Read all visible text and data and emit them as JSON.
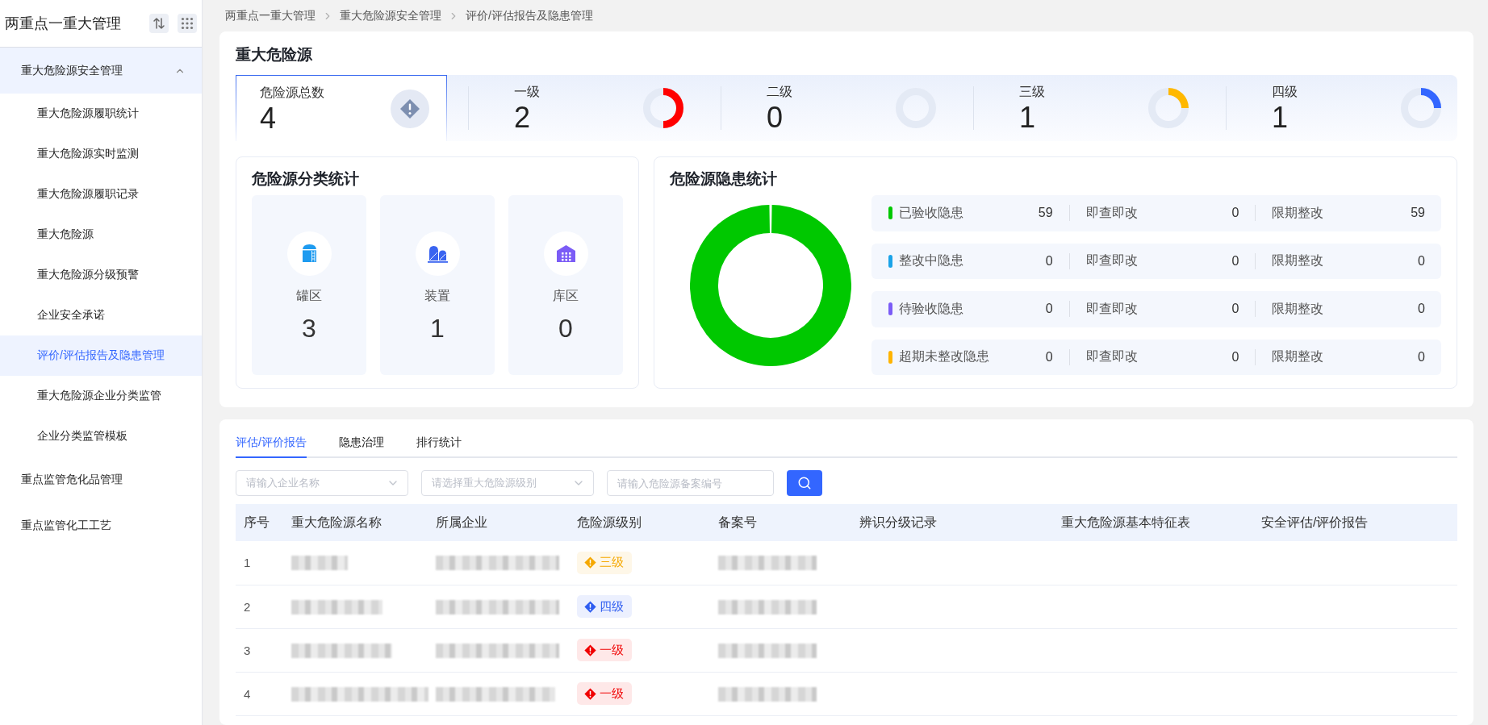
{
  "sidebar": {
    "title": "两重点一重大管理",
    "items": [
      {
        "label": "重大危险源安全管理",
        "selected": false,
        "expanded": true,
        "children": [
          {
            "label": "重大危险源履职统计",
            "selected": false
          },
          {
            "label": "重大危险源实时监测",
            "selected": false
          },
          {
            "label": "重大危险源履职记录",
            "selected": false
          },
          {
            "label": "重大危险源",
            "selected": false
          },
          {
            "label": "重大危险源分级预警",
            "selected": false
          },
          {
            "label": "企业安全承诺",
            "selected": false
          },
          {
            "label": "评价/评估报告及隐患管理",
            "selected": true
          },
          {
            "label": "重大危险源企业分类监管",
            "selected": false
          },
          {
            "label": "企业分类监管模板",
            "selected": false
          }
        ]
      },
      {
        "label": "重点监管危化品管理",
        "selected": false
      },
      {
        "label": "重点监管化工工艺",
        "selected": false
      }
    ]
  },
  "breadcrumb": [
    "两重点一重大管理",
    "重大危险源安全管理",
    "评价/评估报告及隐患管理"
  ],
  "hazard_summary": {
    "title": "重大危险源",
    "total": {
      "label": "危险源总数",
      "value": "4"
    },
    "grades": [
      {
        "label": "一级",
        "value": "2",
        "color": "#ff0000"
      },
      {
        "label": "二级",
        "value": "0"
      },
      {
        "label": "三级",
        "value": "1",
        "color": "#ffb800"
      },
      {
        "label": "四级",
        "value": "1",
        "color": "#3366ff"
      }
    ]
  },
  "category_stats": {
    "title": "危险源分类统计",
    "items": [
      {
        "kind": "tank",
        "label": "罐区",
        "value": "3"
      },
      {
        "kind": "device",
        "label": "装置",
        "value": "1"
      },
      {
        "kind": "warehouse",
        "label": "库区",
        "value": "0"
      }
    ]
  },
  "hidden_danger_stats": {
    "title": "危险源隐患统计",
    "rows": [
      {
        "label": "已验收隐患",
        "count": "59",
        "color": "#00c800",
        "parts": [
          {
            "label": "即查即改",
            "count": "0"
          },
          {
            "label": "限期整改",
            "count": "59"
          }
        ]
      },
      {
        "label": "整改中隐患",
        "count": "0",
        "color": "#1aa3e8",
        "parts": [
          {
            "label": "即查即改",
            "count": "0"
          },
          {
            "label": "限期整改",
            "count": "0"
          }
        ]
      },
      {
        "label": "待验收隐患",
        "count": "0",
        "color": "#7b5cf6",
        "parts": [
          {
            "label": "即查即改",
            "count": "0"
          },
          {
            "label": "限期整改",
            "count": "0"
          }
        ]
      },
      {
        "label": "超期未整改隐患",
        "count": "0",
        "color": "#ffb400",
        "parts": [
          {
            "label": "即查即改",
            "count": "0"
          },
          {
            "label": "限期整改",
            "count": "0"
          }
        ]
      }
    ]
  },
  "tabs": [
    {
      "label": "评估/评价报告",
      "selected": true
    },
    {
      "label": "隐患治理",
      "selected": false
    },
    {
      "label": "排行统计",
      "selected": false
    }
  ],
  "filters": [
    {
      "kind": "select",
      "placeholder": "请输入企业名称"
    },
    {
      "kind": "select",
      "placeholder": "请选择重大危险源级别"
    },
    {
      "kind": "input",
      "placeholder": "请输入危险源备案编号"
    }
  ],
  "table": {
    "columns": [
      "序号",
      "重大危险源名称",
      "所属企业",
      "危险源级别",
      "备案号",
      "辨识分级记录",
      "重大危险源基本特征表",
      "安全评估/评价报告"
    ],
    "rows": [
      {
        "index": "1",
        "grade": {
          "text": "三级",
          "color": "#f5a800"
        }
      },
      {
        "index": "2",
        "grade": {
          "text": "四级",
          "color": "#2f5df0"
        }
      },
      {
        "index": "3",
        "grade": {
          "text": "一级",
          "color": "#f00000"
        }
      },
      {
        "index": "4",
        "grade": {
          "text": "一级",
          "color": "#f00000"
        }
      }
    ]
  }
}
